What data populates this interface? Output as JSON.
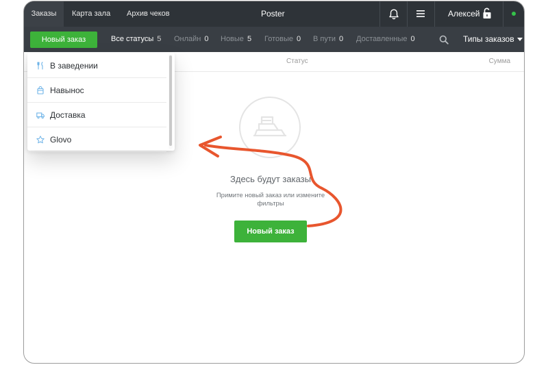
{
  "topbar": {
    "tabs": [
      {
        "label": "Заказы",
        "active": true
      },
      {
        "label": "Карта зала",
        "active": false
      },
      {
        "label": "Архив чеков",
        "active": false
      }
    ],
    "app_title": "Poster",
    "user_name": "Алексей",
    "icons": [
      "bell-icon",
      "menu-icon",
      "lock-open-icon"
    ],
    "online_color": "#35c24a"
  },
  "statusbar": {
    "new_order_label": "Новый заказ",
    "statuses": [
      {
        "label": "Все статусы",
        "count": "5",
        "active": true
      },
      {
        "label": "Онлайн",
        "count": "0",
        "active": false
      },
      {
        "label": "Новые",
        "count": "5",
        "active": false
      },
      {
        "label": "Готовые",
        "count": "0",
        "active": false
      },
      {
        "label": "В пути",
        "count": "0",
        "active": false
      },
      {
        "label": "Доставленные",
        "count": "0",
        "active": false
      }
    ],
    "order_types_label": "Типы заказов"
  },
  "columns": {
    "status": "Статус",
    "sum": "Сумма"
  },
  "order_types_menu": {
    "items": [
      {
        "label": "В заведении",
        "icon": "dine-in-icon"
      },
      {
        "label": "Навынос",
        "icon": "takeaway-icon"
      },
      {
        "label": "Доставка",
        "icon": "delivery-icon"
      },
      {
        "label": "Glovo",
        "icon": "star-icon"
      }
    ]
  },
  "empty_state": {
    "title": "Здесь будут заказы",
    "hint": "Примите новый заказ или измените фильтры",
    "button_label": "Новый заказ"
  },
  "colors": {
    "accent_green": "#3db23a",
    "topbar_bg": "#2e3338",
    "statusbar_bg": "#393e44",
    "annotation_arrow": "#e8562e"
  }
}
